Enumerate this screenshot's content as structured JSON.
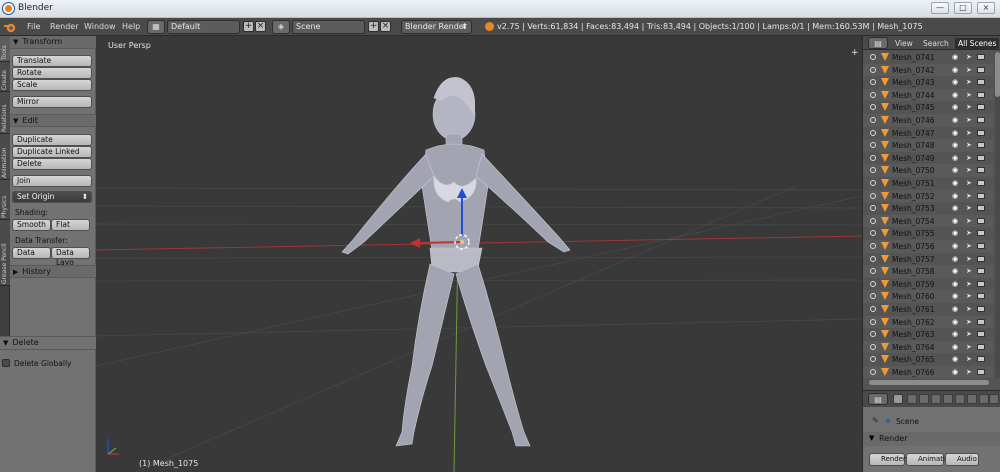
{
  "window": {
    "title": "Blender",
    "minimize": "—",
    "maximize": "□",
    "close": "×"
  },
  "menu": {
    "items": [
      "File",
      "Render",
      "Window",
      "Help"
    ]
  },
  "header": {
    "screen_layout": "Default",
    "scene": "Scene",
    "engine": "Blender Render",
    "stats": "v2.75 | Verts:61,834 | Faces:83,494 | Tris:83,494 | Objects:1/100 | Lamps:0/1 | Mem:160.53M | Mesh_1075"
  },
  "tabs": [
    "Tools",
    "Create",
    "Relations",
    "Animation",
    "Physics",
    "Grease Pencil"
  ],
  "toolshelf": {
    "transform_title": "Transform",
    "translate": "Translate",
    "rotate": "Rotate",
    "scale": "Scale",
    "mirror": "Mirror",
    "edit_title": "Edit",
    "duplicate": "Duplicate",
    "duplicate_linked": "Duplicate Linked",
    "delete": "Delete",
    "join": "Join",
    "set_origin": "Set Origin",
    "shading_label": "Shading:",
    "smooth": "Smooth",
    "flat": "Flat",
    "data_transfer_label": "Data Transfer:",
    "data": "Data",
    "data_layo": "Data Layo",
    "history_title": "History"
  },
  "operator_panel": {
    "title": "Delete",
    "delete_globally": "Delete Globally"
  },
  "viewport": {
    "view_name": "User Persp",
    "object_info": "(1) Mesh_1075"
  },
  "outliner": {
    "view": "View",
    "search": "Search",
    "filter": "All Scenes",
    "items": [
      "Mesh_0741",
      "Mesh_0742",
      "Mesh_0743",
      "Mesh_0744",
      "Mesh_0745",
      "Mesh_0746",
      "Mesh_0747",
      "Mesh_0748",
      "Mesh_0749",
      "Mesh_0750",
      "Mesh_0751",
      "Mesh_0752",
      "Mesh_0753",
      "Mesh_0754",
      "Mesh_0755",
      "Mesh_0756",
      "Mesh_0757",
      "Mesh_0758",
      "Mesh_0759",
      "Mesh_0760",
      "Mesh_0761",
      "Mesh_0762",
      "Mesh_0763",
      "Mesh_0764",
      "Mesh_0765",
      "Mesh_0766"
    ]
  },
  "properties": {
    "scene": "Scene",
    "render_title": "Render",
    "render_btn": "Render",
    "animation_btn": "Animati",
    "audio_btn": "Audio"
  },
  "colors": {
    "selection_orange": "#f29a36",
    "x_axis": "#a23535",
    "y_axis": "#6c9b3a",
    "z_axis": "#1f4fd6"
  }
}
